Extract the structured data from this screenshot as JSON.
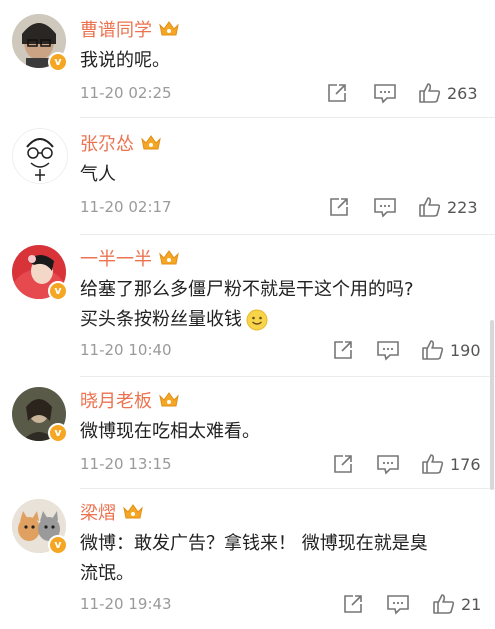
{
  "comments": [
    {
      "user": "曹谱同学",
      "text": "我说的呢。",
      "time": "11-20 02:25",
      "likes": "263"
    },
    {
      "user": "张尕怂",
      "text": "气人",
      "time": "11-20 02:17",
      "likes": "223"
    },
    {
      "user": "一半一半",
      "text_line1": "给塞了那么多僵尸粉不就是干这个用的吗?",
      "text_line2": "买头条按粉丝量收钱",
      "time": "11-20 10:40",
      "likes": "190"
    },
    {
      "user": "晓月老板",
      "text": "微博现在吃相太难看。",
      "time": "11-20 13:15",
      "likes": "176"
    },
    {
      "user": "梁熠",
      "text_line1": "微博：敢发广告？拿钱来！ 微博现在就是臭",
      "text_line2": "流氓。",
      "time": "11-20 19:43",
      "likes": "21"
    }
  ],
  "icons": {
    "share": "share-icon",
    "comment": "comment-icon",
    "like": "thumbs-up-icon",
    "crown": "crown-badge-icon",
    "verified": "verified-v-icon",
    "emoji": "smile-emoji-icon"
  },
  "colors": {
    "username": "#eb7350",
    "verified_badge": "#f5a623",
    "crown": "#f5a623",
    "timestamp": "#9a9a9a"
  }
}
